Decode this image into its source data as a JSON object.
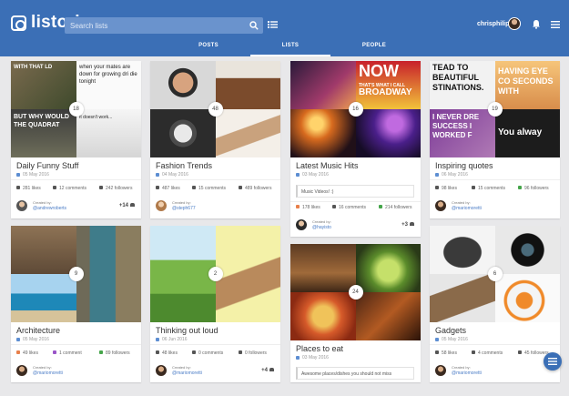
{
  "app": {
    "name": "listori"
  },
  "search": {
    "placeholder": "Search lists"
  },
  "user": {
    "name": "chrisphilips"
  },
  "tabs": [
    {
      "label": "POSTS",
      "active": false
    },
    {
      "label": "LISTS",
      "active": true
    },
    {
      "label": "PEOPLE",
      "active": false
    }
  ],
  "colors": {
    "header": "#3b6fb6",
    "like": "#555555",
    "like_active": "#e8804b",
    "comment": "#555555",
    "comment_active": "#9a55c8",
    "follower": "#555555",
    "follower_active": "#45a54a"
  },
  "cards": [
    {
      "title": "Daily Funny Stuff",
      "date": "05 May 2016",
      "image_count": "18",
      "tile_captions": [
        "WITH THAT LD",
        "when your mates are down for growing dri die tonight",
        "BUT WHY WOULD THE QUADRAT",
        "It doesn't work... "
      ],
      "likes": "281 likes",
      "comments": "12 comments",
      "followers": "242 followers",
      "created_by": "Created by:",
      "author": "@andrewroberts",
      "extra": "+14"
    },
    {
      "title": "Fashion Trends",
      "date": "04 May 2016",
      "image_count": "48",
      "tile_captions": [],
      "likes": "487 likes",
      "comments": "15 comments",
      "followers": "489 followers",
      "created_by": "Created by:",
      "author": "@steph677",
      "extra": ""
    },
    {
      "title": "Latest Music Hits",
      "date": "03 May 2016",
      "image_count": "16",
      "tile_captions": [
        "NOW",
        "THAT'S WHAT I CALL",
        "BROADWAY"
      ],
      "description": "Music Videos! :)",
      "likes": "178 likes",
      "comments": "16 comments",
      "followers": "214 followers",
      "created_by": "Created by:",
      "author": "@hayisto",
      "extra": "+3"
    },
    {
      "title": "Inspiring quotes",
      "date": "06 May 2016",
      "image_count": "19",
      "tile_captions": [
        "TEAD TO BEAUTIFUL STINATIONS.",
        "HAVING EYE CO SECONDS WITH",
        "I NEVER DRE SUCCESS I WORKED F",
        "You alway"
      ],
      "likes": "98 likes",
      "comments": "15 comments",
      "followers": "96 followers",
      "created_by": "Created by:",
      "author": "@mariomoretti",
      "extra": ""
    },
    {
      "title": "Architecture",
      "date": "05 May 2016",
      "image_count": "9",
      "tile_captions": [],
      "likes": "49 likes",
      "comments": "1 comment",
      "followers": "89 followers",
      "created_by": "Created by:",
      "author": "@mariomoretti",
      "extra": ""
    },
    {
      "title": "Thinking out loud",
      "date": "06 Jun 2016",
      "image_count": "2",
      "tile_captions": [],
      "likes": "48 likes",
      "comments": "0 comments",
      "followers": "0 followers",
      "created_by": "Created by:",
      "author": "@mariomoretti",
      "extra": "+4"
    },
    {
      "title": "Places to eat",
      "date": "03 May 2016",
      "image_count": "24",
      "tile_captions": [],
      "description": "Awesome places/dishes you should not miss",
      "likes": "",
      "comments": "",
      "followers": "",
      "created_by": "",
      "author": "",
      "extra": ""
    },
    {
      "title": "Gadgets",
      "date": "05 May 2016",
      "image_count": "6",
      "tile_captions": [],
      "likes": "58 likes",
      "comments": "4 comments",
      "followers": "45 followers",
      "created_by": "Created by:",
      "author": "@mariomoretti",
      "extra": ""
    }
  ]
}
